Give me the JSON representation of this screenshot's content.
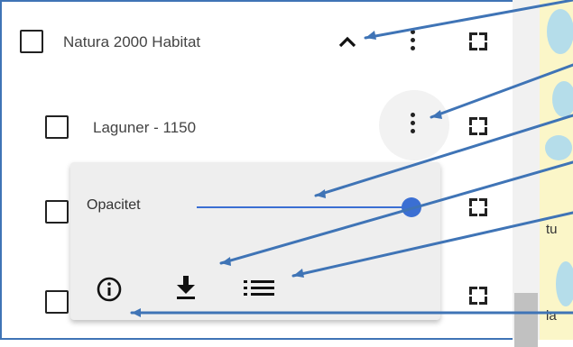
{
  "layers": [
    {
      "label": "Natura 2000 Habitat"
    },
    {
      "label": "Laguner - 1150"
    }
  ],
  "popup": {
    "opacity_label": "Opacitet",
    "opacity_value": 1.0
  },
  "map_labels": [
    "tu",
    "la"
  ],
  "colors": {
    "frame_border": "#3f74b6",
    "slider": "#3b6fd3",
    "callout_line": "#3f74b6"
  },
  "icons": [
    "chevron-up-icon",
    "more-vertical-icon",
    "fullscreen-icon",
    "info-icon",
    "download-icon",
    "list-icon"
  ]
}
